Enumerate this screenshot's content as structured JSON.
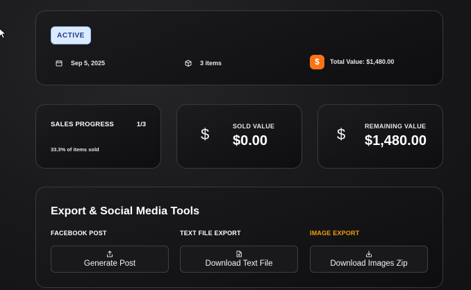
{
  "status_badge": "ACTIVE",
  "summary": {
    "date": "Sep 5, 2025",
    "items": "3 items",
    "total_value": "Total Value: $1,480.00",
    "icons": [
      "calendar-icon",
      "box-icon",
      "dollar-icon"
    ]
  },
  "progress": {
    "label": "SALES PROGRESS",
    "count": "1/3",
    "subtext": "33.3% of items sold"
  },
  "sold": {
    "symbol": "$",
    "label": "SOLD VALUE",
    "amount": "$0.00"
  },
  "remaining": {
    "symbol": "$",
    "label": "REMAINING VALUE",
    "amount": "$1,480.00"
  },
  "tools": {
    "title": "Export & Social Media Tools",
    "columns": [
      {
        "label": "FACEBOOK POST",
        "button": "Generate Post",
        "icon": "share-icon"
      },
      {
        "label": "TEXT FILE EXPORT",
        "button": "Download Text File",
        "icon": "file-icon"
      },
      {
        "label": "IMAGE EXPORT",
        "button": "Download Images Zip",
        "icon": "download-icon"
      }
    ]
  },
  "colors": {
    "accent_orange": "#f97316",
    "badge_bg": "#dbeafe",
    "badge_text": "#1e3a8a",
    "label_orange": "#f59e0b"
  }
}
